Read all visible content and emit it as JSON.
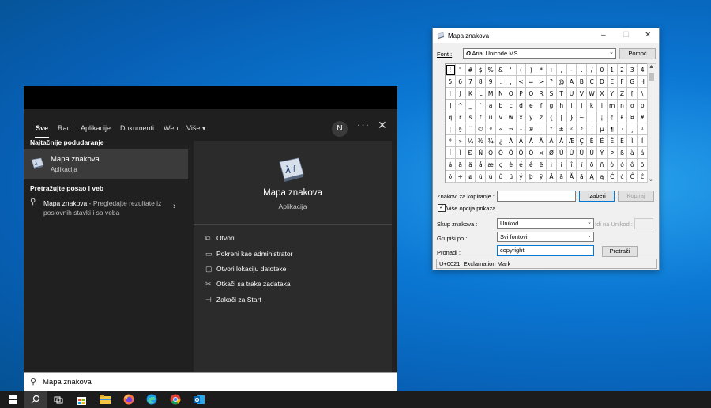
{
  "start": {
    "tabs": [
      {
        "label": "Sve",
        "active": true
      },
      {
        "label": "Rad"
      },
      {
        "label": "Aplikacije"
      },
      {
        "label": "Dokumenti"
      },
      {
        "label": "Web"
      },
      {
        "label": "Više"
      }
    ],
    "more_arrow": "▾",
    "avatar": "N",
    "dots": "···",
    "close": "✕",
    "best_match_heading": "Najtačnije podudaranje",
    "best_match": {
      "title": "Mapa znakova",
      "subtitle": "Aplikacija"
    },
    "web_heading": "Pretražujte posao i veb",
    "web_result": {
      "title": "Mapa znakova",
      "rest": " - Pregledajte rezultate iz poslovnih stavki i sa veba"
    },
    "preview": {
      "title": "Mapa znakova",
      "subtitle": "Aplikacija"
    },
    "actions": [
      {
        "label": "Otvori",
        "icon": "open-icon"
      },
      {
        "label": "Pokreni kao administrator",
        "icon": "admin-icon"
      },
      {
        "label": "Otvori lokaciju datoteke",
        "icon": "folder-icon"
      },
      {
        "label": "Otkači sa trake zadataka",
        "icon": "unpin-icon"
      },
      {
        "label": "Zakači za Start",
        "icon": "pin-icon"
      }
    ],
    "search_value": "Mapa znakova"
  },
  "charmap": {
    "title": "Mapa znakova",
    "font_label": "Font :",
    "font_value": "Arial Unicode MS",
    "help_button": "Pomoć",
    "rows": [
      [
        "!",
        "\"",
        "#",
        "$",
        "%",
        "&",
        "'",
        "(",
        ")",
        "*",
        "+",
        ",",
        "-",
        ".",
        "/",
        "0",
        "1",
        "2",
        "3",
        "4"
      ],
      [
        "5",
        "6",
        "7",
        "8",
        "9",
        ":",
        ";",
        "<",
        "=",
        ">",
        "?",
        "@",
        "A",
        "B",
        "C",
        "D",
        "E",
        "F",
        "G",
        "H"
      ],
      [
        "I",
        "J",
        "K",
        "L",
        "M",
        "N",
        "O",
        "P",
        "Q",
        "R",
        "S",
        "T",
        "U",
        "V",
        "W",
        "X",
        "Y",
        "Z",
        "[",
        "\\"
      ],
      [
        "]",
        "^",
        "_",
        "`",
        "a",
        "b",
        "c",
        "d",
        "e",
        "f",
        "g",
        "h",
        "i",
        "j",
        "k",
        "l",
        "m",
        "n",
        "o",
        "p"
      ],
      [
        "q",
        "r",
        "s",
        "t",
        "u",
        "v",
        "w",
        "x",
        "y",
        "z",
        "{",
        "|",
        "}",
        "~",
        " ",
        "¡",
        "¢",
        "£",
        "¤",
        "¥"
      ],
      [
        "¦",
        "§",
        "¨",
        "©",
        "ª",
        "«",
        "¬",
        "-",
        "®",
        "¯",
        "°",
        "±",
        "²",
        "³",
        "´",
        "µ",
        "¶",
        "·",
        "¸",
        "¹"
      ],
      [
        "º",
        "»",
        "¼",
        "½",
        "¾",
        "¿",
        "À",
        "Á",
        "Â",
        "Ã",
        "Ä",
        "Å",
        "Æ",
        "Ç",
        "È",
        "É",
        "Ê",
        "Ë",
        "Ì",
        "Í"
      ],
      [
        "Î",
        "Ï",
        "Ð",
        "Ñ",
        "Ò",
        "Ó",
        "Ô",
        "Õ",
        "Ö",
        "×",
        "Ø",
        "Ù",
        "Ú",
        "Û",
        "Ü",
        "Ý",
        "Þ",
        "ß",
        "à",
        "á"
      ],
      [
        "â",
        "ã",
        "ä",
        "å",
        "æ",
        "ç",
        "è",
        "é",
        "ê",
        "ë",
        "ì",
        "í",
        "î",
        "ï",
        "ð",
        "ñ",
        "ò",
        "ó",
        "ô",
        "õ"
      ],
      [
        "ö",
        "÷",
        "ø",
        "ù",
        "ú",
        "û",
        "ü",
        "ý",
        "þ",
        "ÿ",
        "Ā",
        "ā",
        "Ă",
        "ă",
        "Ą",
        "ą",
        "Ć",
        "ć",
        "Ĉ",
        "ĉ"
      ]
    ],
    "copy_label": "Znakovi za kopiranje :",
    "copy_value": "",
    "select_button": "Izaberi",
    "copy_button": "Kopiraj",
    "advanced_label": "Više opcija prikaza",
    "advanced_checked": "✓",
    "charset_label": "Skup znakova :",
    "charset_value": "Unikod",
    "unicode_goto_label": "Idi na Unikod :",
    "groupby_label": "Grupiši po :",
    "groupby_value": "Svi fontovi",
    "find_label": "Pronađi :",
    "find_value": "copyright",
    "search_button": "Pretraži",
    "status": "U+0021: Exclamation Mark"
  },
  "taskbar": {
    "items": [
      "windows-start-icon",
      "search-icon",
      "task-view-icon",
      "store-icon",
      "file-explorer-icon",
      "firefox-icon",
      "edge-icon",
      "chrome-icon",
      "outlook-icon"
    ]
  }
}
